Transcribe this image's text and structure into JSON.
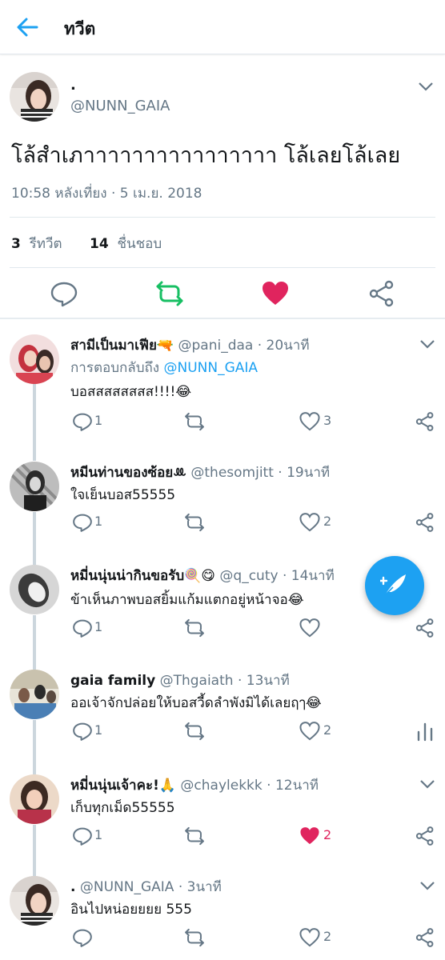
{
  "appbar": {
    "title": "ทวีต"
  },
  "main_tweet": {
    "name": ".",
    "handle": "@NUNN_GAIA",
    "text": "โล้สำเภาาาาาาาาาาาาาาาา โล้เลยโล้เลย",
    "timestamp": "10:58 หลังเที่ยง · 5 เม.ย. 2018",
    "retweet_count": "3",
    "retweet_label": "รีทวีต",
    "like_count": "14",
    "like_label": "ชื่นชอบ",
    "liked": true
  },
  "replies": [
    {
      "name": "สามีเป็นมาเฟีย🔫",
      "handle": "@pani_daa",
      "time": "20นาที",
      "reply_to_label": "การตอบกลับถึง",
      "reply_to": "@NUNN_GAIA",
      "text": "บอสสสสสสสส!!!!😂",
      "reply_count": "1",
      "like_count": "3",
      "liked": false
    },
    {
      "name": "หมีนท่านของซ้อยꔛ",
      "handle": "@thesomjitt",
      "time": "19นาที",
      "text": "ใจเย็นบอส55555",
      "reply_count": "1",
      "like_count": "2",
      "liked": false
    },
    {
      "name": "หมี่นนุ่นน่ากินขอรับ🍭😋",
      "handle": "@q_cuty",
      "time": "14นาที",
      "text": "ข้าเห็นภาพบอสยิ้มแก้มแตกอยู่หน้าจอ😂",
      "reply_count": "1",
      "like_count": "",
      "liked": false
    },
    {
      "name": "gaia family",
      "handle": "@Thgaiath",
      "time": "13นาที",
      "text": "ออเจ้าจักปล่อยให้บอสวี้ดลำพังมิได้เลยฤๅ😂",
      "reply_count": "1",
      "like_count": "2",
      "liked": false
    },
    {
      "name": "หมี่นนุ่นเจ้าคะ!🙏",
      "handle": "@chaylekkk",
      "time": "12นาที",
      "text": "เก็บทุกเม็ด55555",
      "reply_count": "1",
      "like_count": "2",
      "liked": true
    },
    {
      "name": ".",
      "handle": "@NUNN_GAIA",
      "time": "3นาที",
      "text": "อินไปหน่อยยยย 555",
      "reply_count": "",
      "like_count": "2",
      "liked": false
    }
  ],
  "colors": {
    "accent": "#1da1f2",
    "retweet_green": "#17bf63",
    "like_red": "#e0245e",
    "muted": "#657786",
    "divider": "#e1e8ed"
  },
  "icons": [
    "back-arrow-icon",
    "chevron-down-icon",
    "reply-icon",
    "retweet-icon",
    "heart-icon",
    "share-icon",
    "analytics-icon",
    "compose-feather-icon"
  ]
}
